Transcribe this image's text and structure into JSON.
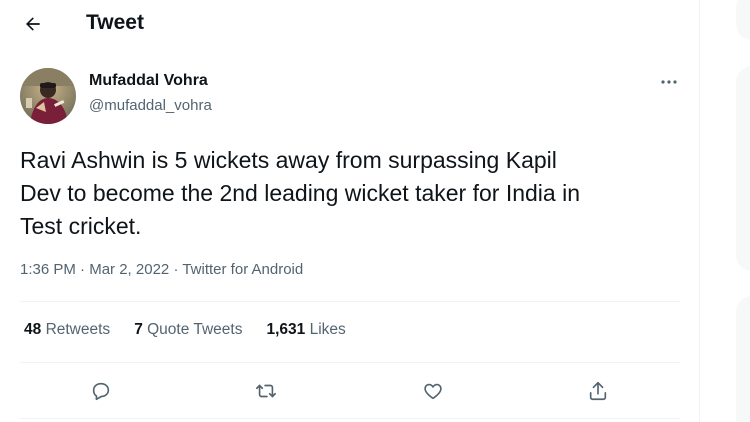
{
  "header": {
    "back_icon": "arrow-left-icon",
    "title": "Tweet"
  },
  "author": {
    "name": "Mufaddal Vohra",
    "handle": "@mufaddal_vohra",
    "avatar_icon": "avatar",
    "more_icon": "more-horizontal-icon"
  },
  "tweet": {
    "line1": "Ravi Ashwin is 5 wickets away from surpassing Kapil",
    "line2": "Dev to become the 2nd leading wicket taker for India in",
    "line3": "Test cricket.",
    "time": "1:36 PM",
    "date": "Mar 2, 2022",
    "source": "Twitter for Android",
    "separator": "·"
  },
  "stats": [
    {
      "count": "48",
      "label": "Retweets"
    },
    {
      "count": "7",
      "label": "Quote Tweets"
    },
    {
      "count": "1,631",
      "label": "Likes"
    }
  ],
  "actions": [
    {
      "icon": "reply-icon"
    },
    {
      "icon": "retweet-icon"
    },
    {
      "icon": "like-heart-icon"
    },
    {
      "icon": "share-icon"
    }
  ],
  "colors": {
    "text": "#0f1419",
    "secondary": "#536471",
    "divider": "#eff3f4"
  }
}
